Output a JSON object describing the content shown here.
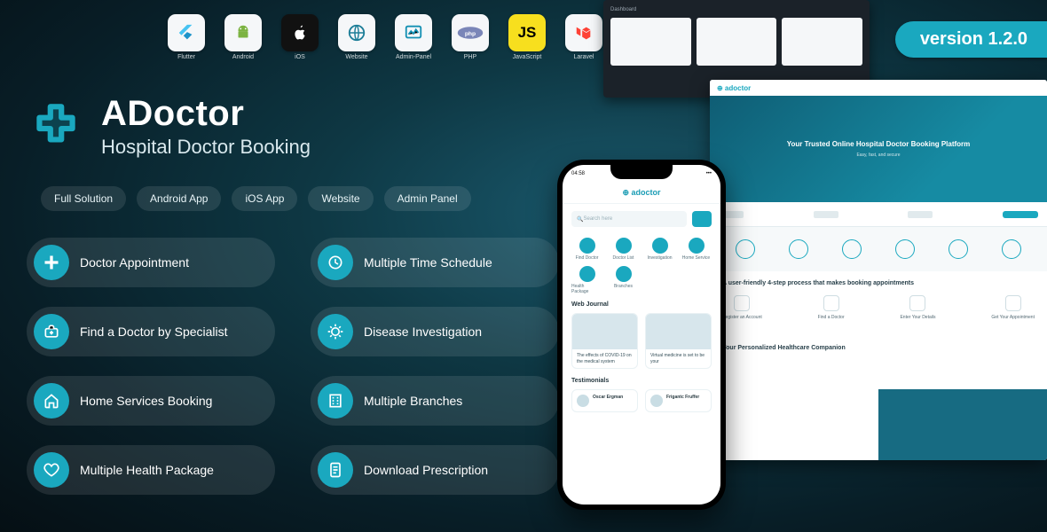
{
  "version_badge": "version 1.2.0",
  "brand": {
    "title": "ADoctor",
    "subtitle": "Hospital Doctor Booking"
  },
  "tech": [
    {
      "label": "Flutter"
    },
    {
      "label": "Android"
    },
    {
      "label": "iOS"
    },
    {
      "label": "Website"
    },
    {
      "label": "Admin-Panel"
    },
    {
      "label": "PHP"
    },
    {
      "label": "JavaScript"
    },
    {
      "label": "Laravel"
    }
  ],
  "categories": [
    "Full Solution",
    "Android App",
    "iOS App",
    "Website",
    "Admin Panel"
  ],
  "features": [
    {
      "label": "Doctor Appointment"
    },
    {
      "label": "Multiple Time Schedule"
    },
    {
      "label": "Find a Doctor by Specialist"
    },
    {
      "label": "Disease Investigation"
    },
    {
      "label": "Home Services Booking"
    },
    {
      "label": "Multiple Branches"
    },
    {
      "label": "Multiple Health Package"
    },
    {
      "label": "Download Prescription"
    }
  ],
  "mock_site": {
    "hero_title": "Your Trusted Online Hospital Doctor Booking Platform",
    "howit_title": "A user-friendly 4-step process that makes booking appointments",
    "steps": [
      "Register an Account",
      "Find a Doctor",
      "Enter Your Details",
      "Get Your Appointment"
    ],
    "band_title": "Your Personalized Healthcare Companion"
  },
  "mock_phone": {
    "time": "04:58",
    "logo": "adoctor",
    "search_placeholder": "Search here",
    "tabs": [
      "Find Doctor",
      "Doctor List",
      "Investigation",
      "Home Service",
      "Health Package",
      "Branches"
    ],
    "section_journal": "Web Journal",
    "journal": [
      "The effects of COVID-19 on the medical system",
      "Virtual medicine is set to be your"
    ],
    "section_testimonial": "Testimonials",
    "testimonials": [
      "Oscar Ergman",
      "Frigantc Fruffer"
    ]
  }
}
